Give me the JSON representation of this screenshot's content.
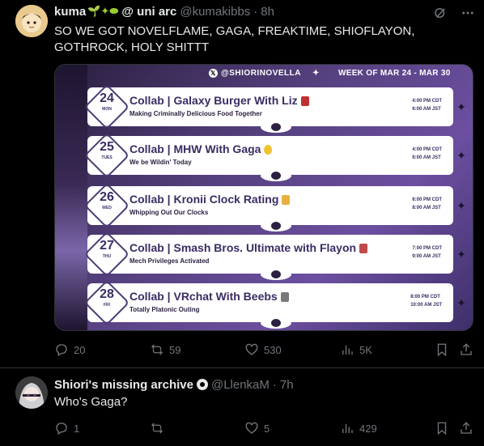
{
  "post1": {
    "author": "kuma",
    "author_emoji": "🌱✦⬬",
    "author_suffix": "@ uni arc",
    "handle": "@kumakibbs",
    "separator": "·",
    "time": "8h",
    "text": "SO WE GOT NOVELFLAME, GAGA, FREAKTIME, SHIOFLAYON, GOTHROCK, HOLY SHITTT",
    "media": {
      "handle": "@SHIORINOVELLA",
      "week": "WEEK OF MAR 24 - MAR 30",
      "schedule": [
        {
          "num": "24",
          "day": "MON",
          "title": "Collab | Galaxy Burger With Liz",
          "subtitle": "Making Criminally Delicious Food Together",
          "time1": "4:00 PM CDT",
          "time2": "6:00 AM JST",
          "emoji_color": "#c03030"
        },
        {
          "num": "25",
          "day": "TUES",
          "title": "Collab | MHW With Gaga",
          "subtitle": "We be Wildin' Today",
          "time1": "4:00 PM CDT",
          "time2": "6:00 AM JST",
          "emoji_color": "#f2c230"
        },
        {
          "num": "26",
          "day": "WED",
          "title": "Collab | Kronii Clock Rating",
          "subtitle": "Whipping Out Our Clocks",
          "time1": "6:00 PM CDT",
          "time2": "8:00 AM JST",
          "emoji_color": "#e8b040"
        },
        {
          "num": "27",
          "day": "THU",
          "title": "Collab | Smash Bros. Ultimate with Flayon",
          "subtitle": "Mech Privileges Activated",
          "time1": "7:00 PM CDT",
          "time2": "9:00 AM JST",
          "emoji_color": "#c04a4a"
        },
        {
          "num": "28",
          "day": "FRI",
          "title": "Collab | VRchat With Beebs",
          "subtitle": "Totally Platonic Outing",
          "time1": "8:00 PM CDT",
          "time2": "10:00 AM JST",
          "emoji_color": "#7a7a7a"
        }
      ]
    },
    "replies": "20",
    "reposts": "59",
    "likes": "530",
    "views": "5K"
  },
  "post2": {
    "author": "Shiori's missing archive",
    "handle": "@LlenkaM",
    "separator": "·",
    "time": "7h",
    "text": "Who's Gaga?",
    "replies": "1",
    "reposts": "",
    "likes": "5",
    "views": "429"
  },
  "colors": {
    "background": "#000000",
    "text": "#e7e9ea",
    "muted": "#71767b",
    "accent_purple": "#3b2c63"
  },
  "icons": [
    "grok-icon",
    "more-icon",
    "reply-icon",
    "repost-icon",
    "like-icon",
    "views-icon",
    "bookmark-icon",
    "share-icon",
    "verified-badge-icon"
  ]
}
